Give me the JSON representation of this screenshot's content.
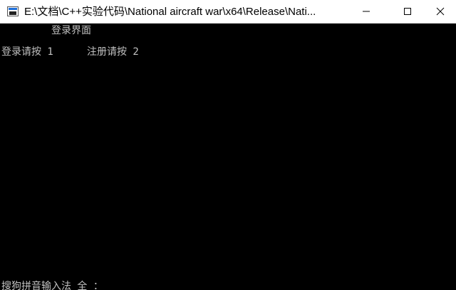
{
  "window": {
    "title": "E:\\文档\\C++实验代码\\National aircraft war\\x64\\Release\\Nati..."
  },
  "controls": {
    "minimize": "minimize-icon",
    "maximize": "maximize-icon",
    "close": "close-icon"
  },
  "console": {
    "heading": "登录界面",
    "option_login": "登录请按 1",
    "option_register": "注册请按 2",
    "ime_status": "搜狗拼音输入法 全 ："
  },
  "colors": {
    "console_bg": "#000000",
    "console_text": "#c0c0c0",
    "titlebar_bg": "#ffffff"
  }
}
